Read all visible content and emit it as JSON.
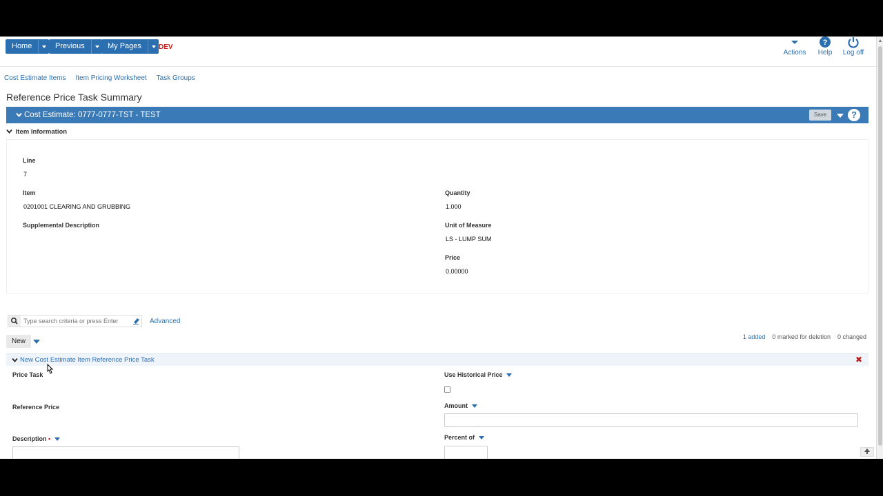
{
  "nav": {
    "home": "Home",
    "previous": "Previous",
    "my_pages": "My Pages",
    "env": "DEV",
    "actions": "Actions",
    "help": "Help",
    "logoff": "Log off"
  },
  "tabs": [
    "Cost Estimate Items",
    "Item Pricing Worksheet",
    "Task Groups"
  ],
  "page_title": "Reference Price Task Summary",
  "banner": {
    "title": "Cost Estimate: 0777-0777-TST - TEST",
    "save": "Save",
    "help_icon": "?"
  },
  "item_info": {
    "header": "Item Information",
    "line_label": "Line",
    "line_value": "7",
    "item_label": "Item",
    "item_value": "0201001 CLEARING AND GRUBBING",
    "supp_label": "Supplemental Description",
    "qty_label": "Quantity",
    "qty_value": "1.000",
    "uom_label": "Unit of Measure",
    "uom_value": "LS - LUMP SUM",
    "price_label": "Price",
    "price_value": "0.00000"
  },
  "search": {
    "placeholder": "Type search criteria or press Enter",
    "advanced": "Advanced"
  },
  "toolbar": {
    "new": "New"
  },
  "counts": {
    "added": "1 added",
    "deleted": "0 marked for deletion",
    "changed": "0 changed"
  },
  "new_row": {
    "title": "New Cost Estimate Item Reference Price Task",
    "price_task_label": "Price Task",
    "reference_price_label": "Reference Price",
    "description_label": "Description",
    "use_hist_label": "Use Historical Price",
    "amount_label": "Amount",
    "percent_label": "Percent of"
  },
  "colors": {
    "nav_blue": "#2b6fb0",
    "banner_blue": "#3a7ab7",
    "env_red": "#c81e1e"
  }
}
